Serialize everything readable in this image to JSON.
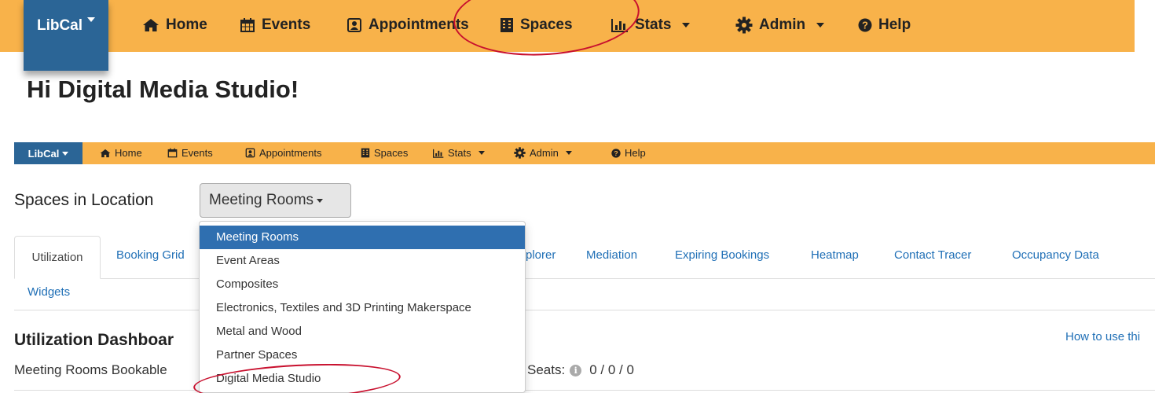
{
  "nav_big": {
    "brand": "LibCal",
    "items": [
      {
        "label": "Home",
        "icon": "home-icon"
      },
      {
        "label": "Events",
        "icon": "calendar-icon"
      },
      {
        "label": "Appointments",
        "icon": "contact-card-icon"
      },
      {
        "label": "Spaces",
        "icon": "building-icon"
      },
      {
        "label": "Stats",
        "icon": "bar-chart-icon"
      },
      {
        "label": "Admin",
        "icon": "gear-icon"
      },
      {
        "label": "Help",
        "icon": "question-circle-icon"
      }
    ]
  },
  "greeting": "Hi Digital Media Studio!",
  "nav_small": {
    "brand": "LibCal",
    "items": [
      {
        "label": "Home"
      },
      {
        "label": "Events"
      },
      {
        "label": "Appointments"
      },
      {
        "label": "Spaces"
      },
      {
        "label": "Stats"
      },
      {
        "label": "Admin"
      },
      {
        "label": "Help"
      }
    ]
  },
  "location": {
    "label": "Spaces in Location",
    "selected": "Meeting Rooms"
  },
  "tabs": {
    "row1": [
      "Utilization",
      "Booking Grid",
      "plorer",
      "Mediation",
      "Expiring Bookings",
      "Heatmap",
      "Contact Tracer",
      "Occupancy Data"
    ],
    "row2": [
      "Widgets"
    ]
  },
  "dashboard": {
    "title": "Utilization Dashboar",
    "howto": "How to use thi",
    "summary": "Meeting Rooms Bookable",
    "seats_label": "Seats:",
    "seats_value": "0 / 0 / 0"
  },
  "dropdown": {
    "items": [
      "Meeting Rooms",
      "Event Areas",
      "Composites",
      "Electronics, Textiles and 3D Printing Makerspace",
      "Metal and Wood",
      "Partner Spaces",
      "Digital Media Studio"
    ],
    "active_index": 0
  },
  "colors": {
    "navbar": "#f8b24a",
    "brand": "#2b6596",
    "link": "#1f6fb6",
    "annotation": "#c8102e"
  }
}
